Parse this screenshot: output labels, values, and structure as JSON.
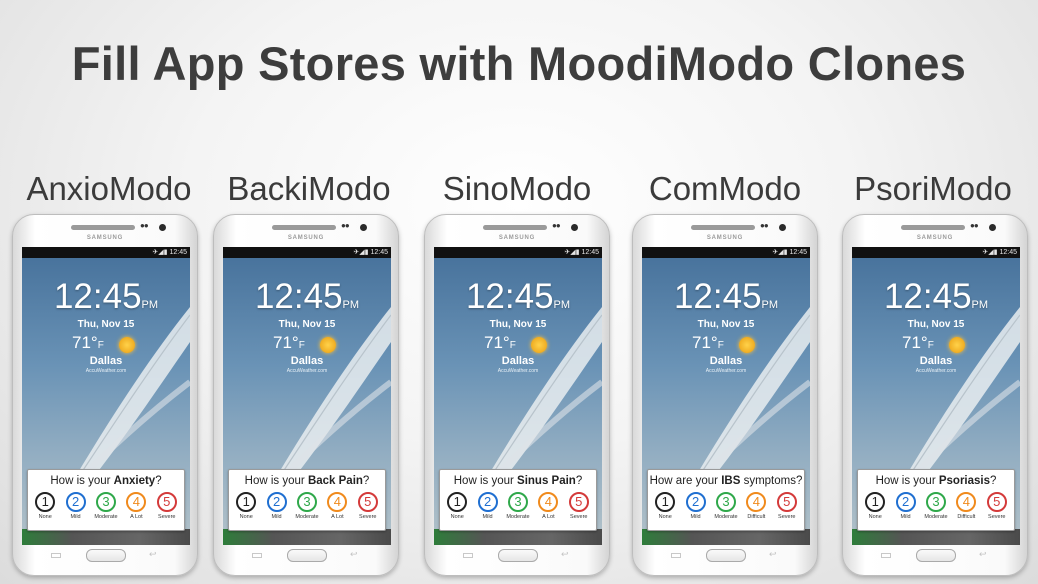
{
  "title": "Fill App Stores with MoodiModo Clones",
  "device": {
    "brand": "SAMSUNG",
    "status_time": "12:45",
    "status_icons": "✈◢▮",
    "clock": "12:45",
    "clock_suffix": "PM",
    "date": "Thu, Nov 15",
    "temperature": "71°",
    "temperature_unit": "F",
    "city": "Dallas",
    "weather_source": "AccuWeather.com",
    "back_glyph": "↩"
  },
  "colors": {
    "none": "#222222",
    "mild": "#1f6fd1",
    "moderate": "#2fa84a",
    "alot": "#f08a1c",
    "severe": "#d43a3a"
  },
  "apps": [
    {
      "name": "AnxioModo",
      "question": {
        "prefix": "How is your ",
        "bold": "Anxiety",
        "suffix": "?"
      },
      "options": [
        {
          "num": "1",
          "label": "None"
        },
        {
          "num": "2",
          "label": "Mild"
        },
        {
          "num": "3",
          "label": "Moderate"
        },
        {
          "num": "4",
          "label": "A Lot"
        },
        {
          "num": "5",
          "label": "Severe"
        }
      ]
    },
    {
      "name": "BackiModo",
      "question": {
        "prefix": "How is your ",
        "bold": "Back Pain",
        "suffix": "?"
      },
      "options": [
        {
          "num": "1",
          "label": "None"
        },
        {
          "num": "2",
          "label": "Mild"
        },
        {
          "num": "3",
          "label": "Moderate"
        },
        {
          "num": "4",
          "label": "A Lot"
        },
        {
          "num": "5",
          "label": "Severe"
        }
      ]
    },
    {
      "name": "SinoModo",
      "question": {
        "prefix": "How is your ",
        "bold": "Sinus Pain",
        "suffix": "?"
      },
      "options": [
        {
          "num": "1",
          "label": "None"
        },
        {
          "num": "2",
          "label": "Mild"
        },
        {
          "num": "3",
          "label": "Moderate"
        },
        {
          "num": "4",
          "label": "A Lot"
        },
        {
          "num": "5",
          "label": "Severe"
        }
      ]
    },
    {
      "name": "ComModo",
      "question": {
        "prefix": "How are your ",
        "bold": "IBS",
        "suffix": " symptoms?"
      },
      "options": [
        {
          "num": "1",
          "label": "None"
        },
        {
          "num": "2",
          "label": "Mild"
        },
        {
          "num": "3",
          "label": "Moderate"
        },
        {
          "num": "4",
          "label": "Difficult"
        },
        {
          "num": "5",
          "label": "Severe"
        }
      ]
    },
    {
      "name": "PsoriModo",
      "question": {
        "prefix": "How is your ",
        "bold": "Psoriasis",
        "suffix": "?"
      },
      "options": [
        {
          "num": "1",
          "label": "None"
        },
        {
          "num": "2",
          "label": "Mild"
        },
        {
          "num": "3",
          "label": "Moderate"
        },
        {
          "num": "4",
          "label": "Difficult"
        },
        {
          "num": "5",
          "label": "Severe"
        }
      ]
    }
  ]
}
